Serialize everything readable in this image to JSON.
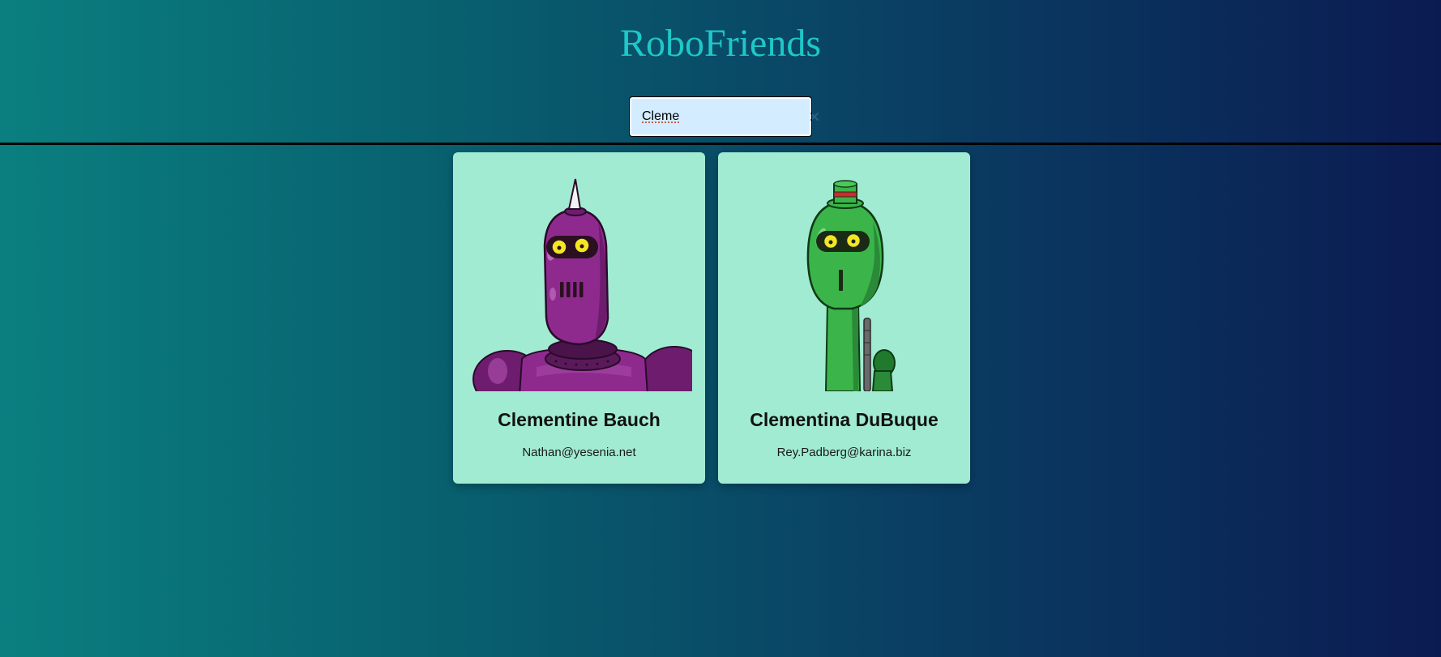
{
  "app": {
    "title": "RoboFriends"
  },
  "search": {
    "value": "Cleme",
    "clear_icon": "close-icon"
  },
  "robots": [
    {
      "name": "Clementine Bauch",
      "email": "Nathan@yesenia.net",
      "color": "#8e2a8e"
    },
    {
      "name": "Clementina DuBuque",
      "email": "Rey.Padberg@karina.biz",
      "color": "#3bb54a"
    }
  ],
  "colors": {
    "card_background": "#a1ebd3",
    "title": "#1ec8c8",
    "search_background": "#d4ecff"
  }
}
